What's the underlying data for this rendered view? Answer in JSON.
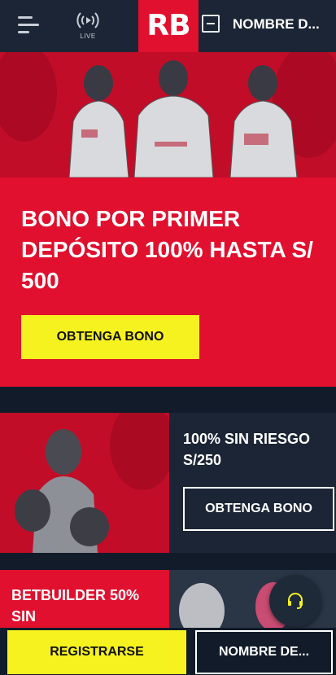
{
  "header": {
    "menu_icon": "hamburger-icon",
    "live_icon": "live-broadcast-icon",
    "live_label": "LIVE",
    "logo_text": "RB",
    "login_icon": "key-icon",
    "login_label": "NOMBRE D..."
  },
  "hero": {
    "title": "BONO POR PRIMER DEPÓSITO 100% HASTA S/ 500",
    "button_label": "OBTENGA BONO"
  },
  "promo2": {
    "title": "100% SIN RIESGO S/250",
    "button_label": "OBTENGA BONO"
  },
  "promo3": {
    "title": "BETBUILDER 50% SIN"
  },
  "support": {
    "icon": "headset-icon"
  },
  "footer": {
    "register_label": "REGISTRARSE",
    "login_label": "NOMBRE DE..."
  },
  "colors": {
    "brand_red": "#e0102e",
    "accent_yellow": "#f5f21f",
    "navy": "#1b2535"
  }
}
